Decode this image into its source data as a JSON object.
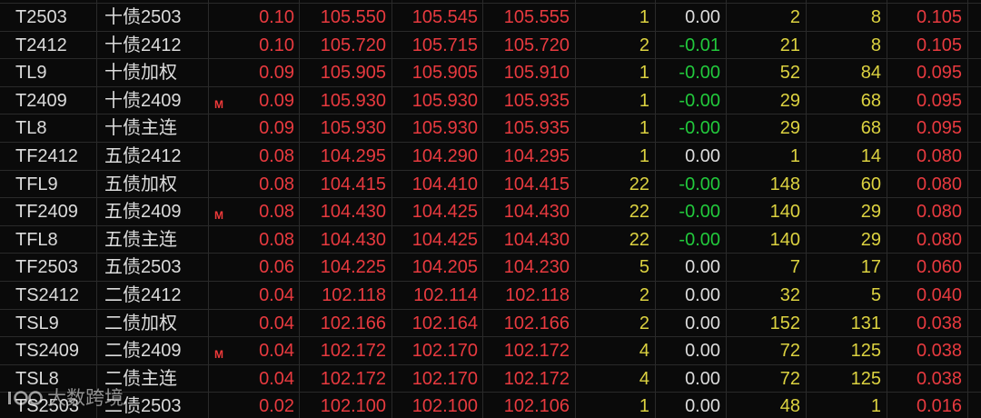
{
  "colors": {
    "background": "#0a0a0a",
    "grid": "#2a2a2a",
    "text": "#dcdcdc",
    "up": "#e83a3f",
    "down": "#22c93c",
    "volume": "#dcd240",
    "flag": "#f03a3a"
  },
  "rows": [
    {
      "code": "T2503",
      "name": "十债2503",
      "flag": "",
      "change": "0.10",
      "last": "105.550",
      "bid": "105.545",
      "ask": "105.555",
      "lots": "1",
      "delta": "0.00",
      "vol": "2",
      "oi": "8",
      "pct": "0.105"
    },
    {
      "code": "T2412",
      "name": "十债2412",
      "flag": "",
      "change": "0.10",
      "last": "105.720",
      "bid": "105.715",
      "ask": "105.720",
      "lots": "2",
      "delta": "-0.01",
      "vol": "21",
      "oi": "8",
      "pct": "0.105"
    },
    {
      "code": "TL9",
      "name": "十债加权",
      "flag": "",
      "change": "0.09",
      "last": "105.905",
      "bid": "105.905",
      "ask": "105.910",
      "lots": "1",
      "delta": "-0.00",
      "vol": "52",
      "oi": "84",
      "pct": "0.095"
    },
    {
      "code": "T2409",
      "name": "十债2409",
      "flag": "M",
      "change": "0.09",
      "last": "105.930",
      "bid": "105.930",
      "ask": "105.935",
      "lots": "1",
      "delta": "-0.00",
      "vol": "29",
      "oi": "68",
      "pct": "0.095"
    },
    {
      "code": "TL8",
      "name": "十债主连",
      "flag": "",
      "change": "0.09",
      "last": "105.930",
      "bid": "105.930",
      "ask": "105.935",
      "lots": "1",
      "delta": "-0.00",
      "vol": "29",
      "oi": "68",
      "pct": "0.095"
    },
    {
      "code": "TF2412",
      "name": "五债2412",
      "flag": "",
      "change": "0.08",
      "last": "104.295",
      "bid": "104.290",
      "ask": "104.295",
      "lots": "1",
      "delta": "0.00",
      "vol": "1",
      "oi": "14",
      "pct": "0.080"
    },
    {
      "code": "TFL9",
      "name": "五债加权",
      "flag": "",
      "change": "0.08",
      "last": "104.415",
      "bid": "104.410",
      "ask": "104.415",
      "lots": "22",
      "delta": "-0.00",
      "vol": "148",
      "oi": "60",
      "pct": "0.080"
    },
    {
      "code": "TF2409",
      "name": "五债2409",
      "flag": "M",
      "change": "0.08",
      "last": "104.430",
      "bid": "104.425",
      "ask": "104.430",
      "lots": "22",
      "delta": "-0.00",
      "vol": "140",
      "oi": "29",
      "pct": "0.080"
    },
    {
      "code": "TFL8",
      "name": "五债主连",
      "flag": "",
      "change": "0.08",
      "last": "104.430",
      "bid": "104.425",
      "ask": "104.430",
      "lots": "22",
      "delta": "-0.00",
      "vol": "140",
      "oi": "29",
      "pct": "0.080"
    },
    {
      "code": "TF2503",
      "name": "五债2503",
      "flag": "",
      "change": "0.06",
      "last": "104.225",
      "bid": "104.205",
      "ask": "104.230",
      "lots": "5",
      "delta": "0.00",
      "vol": "7",
      "oi": "17",
      "pct": "0.060"
    },
    {
      "code": "TS2412",
      "name": "二债2412",
      "flag": "",
      "change": "0.04",
      "last": "102.118",
      "bid": "102.114",
      "ask": "102.118",
      "lots": "2",
      "delta": "0.00",
      "vol": "32",
      "oi": "5",
      "pct": "0.040"
    },
    {
      "code": "TSL9",
      "name": "二债加权",
      "flag": "",
      "change": "0.04",
      "last": "102.166",
      "bid": "102.164",
      "ask": "102.166",
      "lots": "2",
      "delta": "0.00",
      "vol": "152",
      "oi": "131",
      "pct": "0.038"
    },
    {
      "code": "TS2409",
      "name": "二债2409",
      "flag": "M",
      "change": "0.04",
      "last": "102.172",
      "bid": "102.170",
      "ask": "102.172",
      "lots": "4",
      "delta": "0.00",
      "vol": "72",
      "oi": "125",
      "pct": "0.038"
    },
    {
      "code": "TSL8",
      "name": "二债主连",
      "flag": "",
      "change": "0.04",
      "last": "102.172",
      "bid": "102.170",
      "ask": "102.172",
      "lots": "4",
      "delta": "0.00",
      "vol": "72",
      "oi": "125",
      "pct": "0.038"
    },
    {
      "code": "TS2503",
      "name": "二债2503",
      "flag": "",
      "change": "0.02",
      "last": "102.100",
      "bid": "102.100",
      "ask": "102.106",
      "lots": "1",
      "delta": "0.00",
      "vol": "48",
      "oi": "1",
      "pct": "0.016"
    }
  ],
  "watermark": {
    "logo_icon": "watermark-logo-icon",
    "text": "大数跨境"
  }
}
